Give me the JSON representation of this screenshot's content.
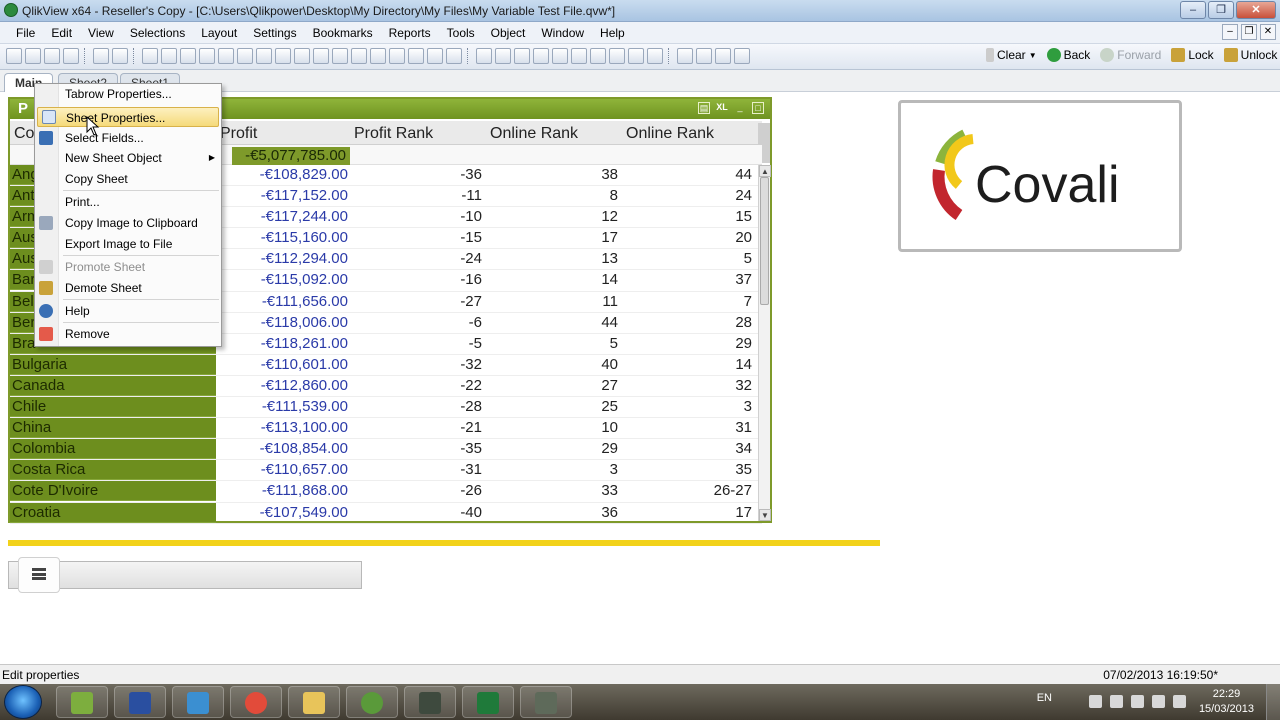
{
  "window": {
    "title": "QlikView x64 - Reseller's Copy - [C:\\Users\\Qlikpower\\Desktop\\My Directory\\My Files\\My Variable Test File.qvw*]"
  },
  "menu": [
    "File",
    "Edit",
    "View",
    "Selections",
    "Layout",
    "Settings",
    "Bookmarks",
    "Reports",
    "Tools",
    "Object",
    "Window",
    "Help"
  ],
  "toolbar": {
    "clear": "Clear",
    "back": "Back",
    "forward": "Forward",
    "lock": "Lock",
    "unlock": "Unlock"
  },
  "tabs": [
    "Main",
    "Sheet2",
    "Sheet1"
  ],
  "table": {
    "caption": "P",
    "headers": {
      "country": "Co",
      "profit": "Profit",
      "profit_rank": "Profit Rank",
      "online_rank_1": "Online Rank",
      "online_rank_2": "Online Rank"
    },
    "total_profit": "-€5,077,785.00",
    "rows": [
      {
        "country": "Ang",
        "profit": "-€108,829.00",
        "profit_rank": "-36",
        "online_rank_1": "38",
        "online_rank_2": "44"
      },
      {
        "country": "Ant",
        "profit": "-€117,152.00",
        "profit_rank": "-11",
        "online_rank_1": "8",
        "online_rank_2": "24"
      },
      {
        "country": "Arm",
        "profit": "-€117,244.00",
        "profit_rank": "-10",
        "online_rank_1": "12",
        "online_rank_2": "15"
      },
      {
        "country": "Aus",
        "profit": "-€115,160.00",
        "profit_rank": "-15",
        "online_rank_1": "17",
        "online_rank_2": "20"
      },
      {
        "country": "Aus",
        "profit": "-€112,294.00",
        "profit_rank": "-24",
        "online_rank_1": "13",
        "online_rank_2": "5"
      },
      {
        "country": "Bar",
        "profit": "-€115,092.00",
        "profit_rank": "-16",
        "online_rank_1": "14",
        "online_rank_2": "37"
      },
      {
        "country": "Bel",
        "profit": "-€111,656.00",
        "profit_rank": "-27",
        "online_rank_1": "11",
        "online_rank_2": "7"
      },
      {
        "country": "Ber",
        "profit": "-€118,006.00",
        "profit_rank": "-6",
        "online_rank_1": "44",
        "online_rank_2": "28"
      },
      {
        "country": "Bra",
        "profit": "-€118,261.00",
        "profit_rank": "-5",
        "online_rank_1": "5",
        "online_rank_2": "29"
      },
      {
        "country": "Bulgaria",
        "profit": "-€110,601.00",
        "profit_rank": "-32",
        "online_rank_1": "40",
        "online_rank_2": "14"
      },
      {
        "country": "Canada",
        "profit": "-€112,860.00",
        "profit_rank": "-22",
        "online_rank_1": "27",
        "online_rank_2": "32"
      },
      {
        "country": "Chile",
        "profit": "-€111,539.00",
        "profit_rank": "-28",
        "online_rank_1": "25",
        "online_rank_2": "3"
      },
      {
        "country": "China",
        "profit": "-€113,100.00",
        "profit_rank": "-21",
        "online_rank_1": "10",
        "online_rank_2": "31"
      },
      {
        "country": "Colombia",
        "profit": "-€108,854.00",
        "profit_rank": "-35",
        "online_rank_1": "29",
        "online_rank_2": "34"
      },
      {
        "country": "Costa Rica",
        "profit": "-€110,657.00",
        "profit_rank": "-31",
        "online_rank_1": "3",
        "online_rank_2": "35"
      },
      {
        "country": "Cote D'Ivoire",
        "profit": "-€111,868.00",
        "profit_rank": "-26",
        "online_rank_1": "33",
        "online_rank_2": "26-27"
      },
      {
        "country": "Croatia",
        "profit": "-€107,549.00",
        "profit_rank": "-40",
        "online_rank_1": "36",
        "online_rank_2": "17"
      }
    ]
  },
  "context_menu": {
    "items": [
      {
        "label": "Tabrow Properties...",
        "icon": "none",
        "state": "normal"
      },
      {
        "label": "Sheet Properties...",
        "icon": "properties-icon",
        "state": "highlight"
      },
      {
        "label": "Select Fields...",
        "icon": "fields-icon",
        "state": "normal"
      },
      {
        "label": "New Sheet Object",
        "icon": "none",
        "state": "submenu"
      },
      {
        "label": "Copy Sheet",
        "icon": "none",
        "state": "normal"
      },
      {
        "label": "Print...",
        "icon": "none",
        "state": "normal"
      },
      {
        "label": "Copy Image to Clipboard",
        "icon": "clipboard-icon",
        "state": "normal"
      },
      {
        "label": "Export Image to File",
        "icon": "none",
        "state": "normal"
      },
      {
        "label": "Promote Sheet",
        "icon": "promote-icon",
        "state": "disabled"
      },
      {
        "label": "Demote Sheet",
        "icon": "demote-icon",
        "state": "normal"
      },
      {
        "label": "Help",
        "icon": "help-icon",
        "state": "normal"
      },
      {
        "label": "Remove",
        "icon": "remove-icon",
        "state": "normal"
      }
    ]
  },
  "logo": {
    "text": "Covali",
    "colors": [
      "#c2262e",
      "#8cb43c",
      "#f2c81a"
    ]
  },
  "status": {
    "left": "Edit properties",
    "right": "07/02/2013 16:19:50*"
  },
  "taskbar": {
    "lang": "EN",
    "time": "22:29",
    "date": "15/03/2013"
  },
  "colors": {
    "accent_green": "#6d8e1e",
    "caption_green": "#7e9a2a",
    "highlight_yellow": "#f2d21a",
    "profit_text": "#2a3aa8"
  }
}
